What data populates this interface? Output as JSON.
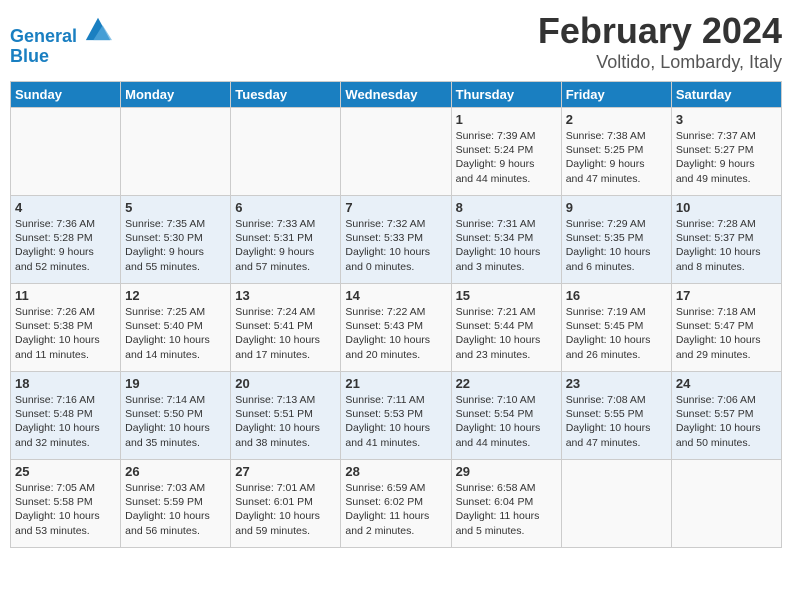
{
  "logo": {
    "line1": "General",
    "line2": "Blue"
  },
  "title": "February 2024",
  "subtitle": "Voltido, Lombardy, Italy",
  "columns": [
    "Sunday",
    "Monday",
    "Tuesday",
    "Wednesday",
    "Thursday",
    "Friday",
    "Saturday"
  ],
  "weeks": [
    [
      {
        "day": "",
        "info": ""
      },
      {
        "day": "",
        "info": ""
      },
      {
        "day": "",
        "info": ""
      },
      {
        "day": "",
        "info": ""
      },
      {
        "day": "1",
        "info": "Sunrise: 7:39 AM\nSunset: 5:24 PM\nDaylight: 9 hours\nand 44 minutes."
      },
      {
        "day": "2",
        "info": "Sunrise: 7:38 AM\nSunset: 5:25 PM\nDaylight: 9 hours\nand 47 minutes."
      },
      {
        "day": "3",
        "info": "Sunrise: 7:37 AM\nSunset: 5:27 PM\nDaylight: 9 hours\nand 49 minutes."
      }
    ],
    [
      {
        "day": "4",
        "info": "Sunrise: 7:36 AM\nSunset: 5:28 PM\nDaylight: 9 hours\nand 52 minutes."
      },
      {
        "day": "5",
        "info": "Sunrise: 7:35 AM\nSunset: 5:30 PM\nDaylight: 9 hours\nand 55 minutes."
      },
      {
        "day": "6",
        "info": "Sunrise: 7:33 AM\nSunset: 5:31 PM\nDaylight: 9 hours\nand 57 minutes."
      },
      {
        "day": "7",
        "info": "Sunrise: 7:32 AM\nSunset: 5:33 PM\nDaylight: 10 hours\nand 0 minutes."
      },
      {
        "day": "8",
        "info": "Sunrise: 7:31 AM\nSunset: 5:34 PM\nDaylight: 10 hours\nand 3 minutes."
      },
      {
        "day": "9",
        "info": "Sunrise: 7:29 AM\nSunset: 5:35 PM\nDaylight: 10 hours\nand 6 minutes."
      },
      {
        "day": "10",
        "info": "Sunrise: 7:28 AM\nSunset: 5:37 PM\nDaylight: 10 hours\nand 8 minutes."
      }
    ],
    [
      {
        "day": "11",
        "info": "Sunrise: 7:26 AM\nSunset: 5:38 PM\nDaylight: 10 hours\nand 11 minutes."
      },
      {
        "day": "12",
        "info": "Sunrise: 7:25 AM\nSunset: 5:40 PM\nDaylight: 10 hours\nand 14 minutes."
      },
      {
        "day": "13",
        "info": "Sunrise: 7:24 AM\nSunset: 5:41 PM\nDaylight: 10 hours\nand 17 minutes."
      },
      {
        "day": "14",
        "info": "Sunrise: 7:22 AM\nSunset: 5:43 PM\nDaylight: 10 hours\nand 20 minutes."
      },
      {
        "day": "15",
        "info": "Sunrise: 7:21 AM\nSunset: 5:44 PM\nDaylight: 10 hours\nand 23 minutes."
      },
      {
        "day": "16",
        "info": "Sunrise: 7:19 AM\nSunset: 5:45 PM\nDaylight: 10 hours\nand 26 minutes."
      },
      {
        "day": "17",
        "info": "Sunrise: 7:18 AM\nSunset: 5:47 PM\nDaylight: 10 hours\nand 29 minutes."
      }
    ],
    [
      {
        "day": "18",
        "info": "Sunrise: 7:16 AM\nSunset: 5:48 PM\nDaylight: 10 hours\nand 32 minutes."
      },
      {
        "day": "19",
        "info": "Sunrise: 7:14 AM\nSunset: 5:50 PM\nDaylight: 10 hours\nand 35 minutes."
      },
      {
        "day": "20",
        "info": "Sunrise: 7:13 AM\nSunset: 5:51 PM\nDaylight: 10 hours\nand 38 minutes."
      },
      {
        "day": "21",
        "info": "Sunrise: 7:11 AM\nSunset: 5:53 PM\nDaylight: 10 hours\nand 41 minutes."
      },
      {
        "day": "22",
        "info": "Sunrise: 7:10 AM\nSunset: 5:54 PM\nDaylight: 10 hours\nand 44 minutes."
      },
      {
        "day": "23",
        "info": "Sunrise: 7:08 AM\nSunset: 5:55 PM\nDaylight: 10 hours\nand 47 minutes."
      },
      {
        "day": "24",
        "info": "Sunrise: 7:06 AM\nSunset: 5:57 PM\nDaylight: 10 hours\nand 50 minutes."
      }
    ],
    [
      {
        "day": "25",
        "info": "Sunrise: 7:05 AM\nSunset: 5:58 PM\nDaylight: 10 hours\nand 53 minutes."
      },
      {
        "day": "26",
        "info": "Sunrise: 7:03 AM\nSunset: 5:59 PM\nDaylight: 10 hours\nand 56 minutes."
      },
      {
        "day": "27",
        "info": "Sunrise: 7:01 AM\nSunset: 6:01 PM\nDaylight: 10 hours\nand 59 minutes."
      },
      {
        "day": "28",
        "info": "Sunrise: 6:59 AM\nSunset: 6:02 PM\nDaylight: 11 hours\nand 2 minutes."
      },
      {
        "day": "29",
        "info": "Sunrise: 6:58 AM\nSunset: 6:04 PM\nDaylight: 11 hours\nand 5 minutes."
      },
      {
        "day": "",
        "info": ""
      },
      {
        "day": "",
        "info": ""
      }
    ]
  ]
}
